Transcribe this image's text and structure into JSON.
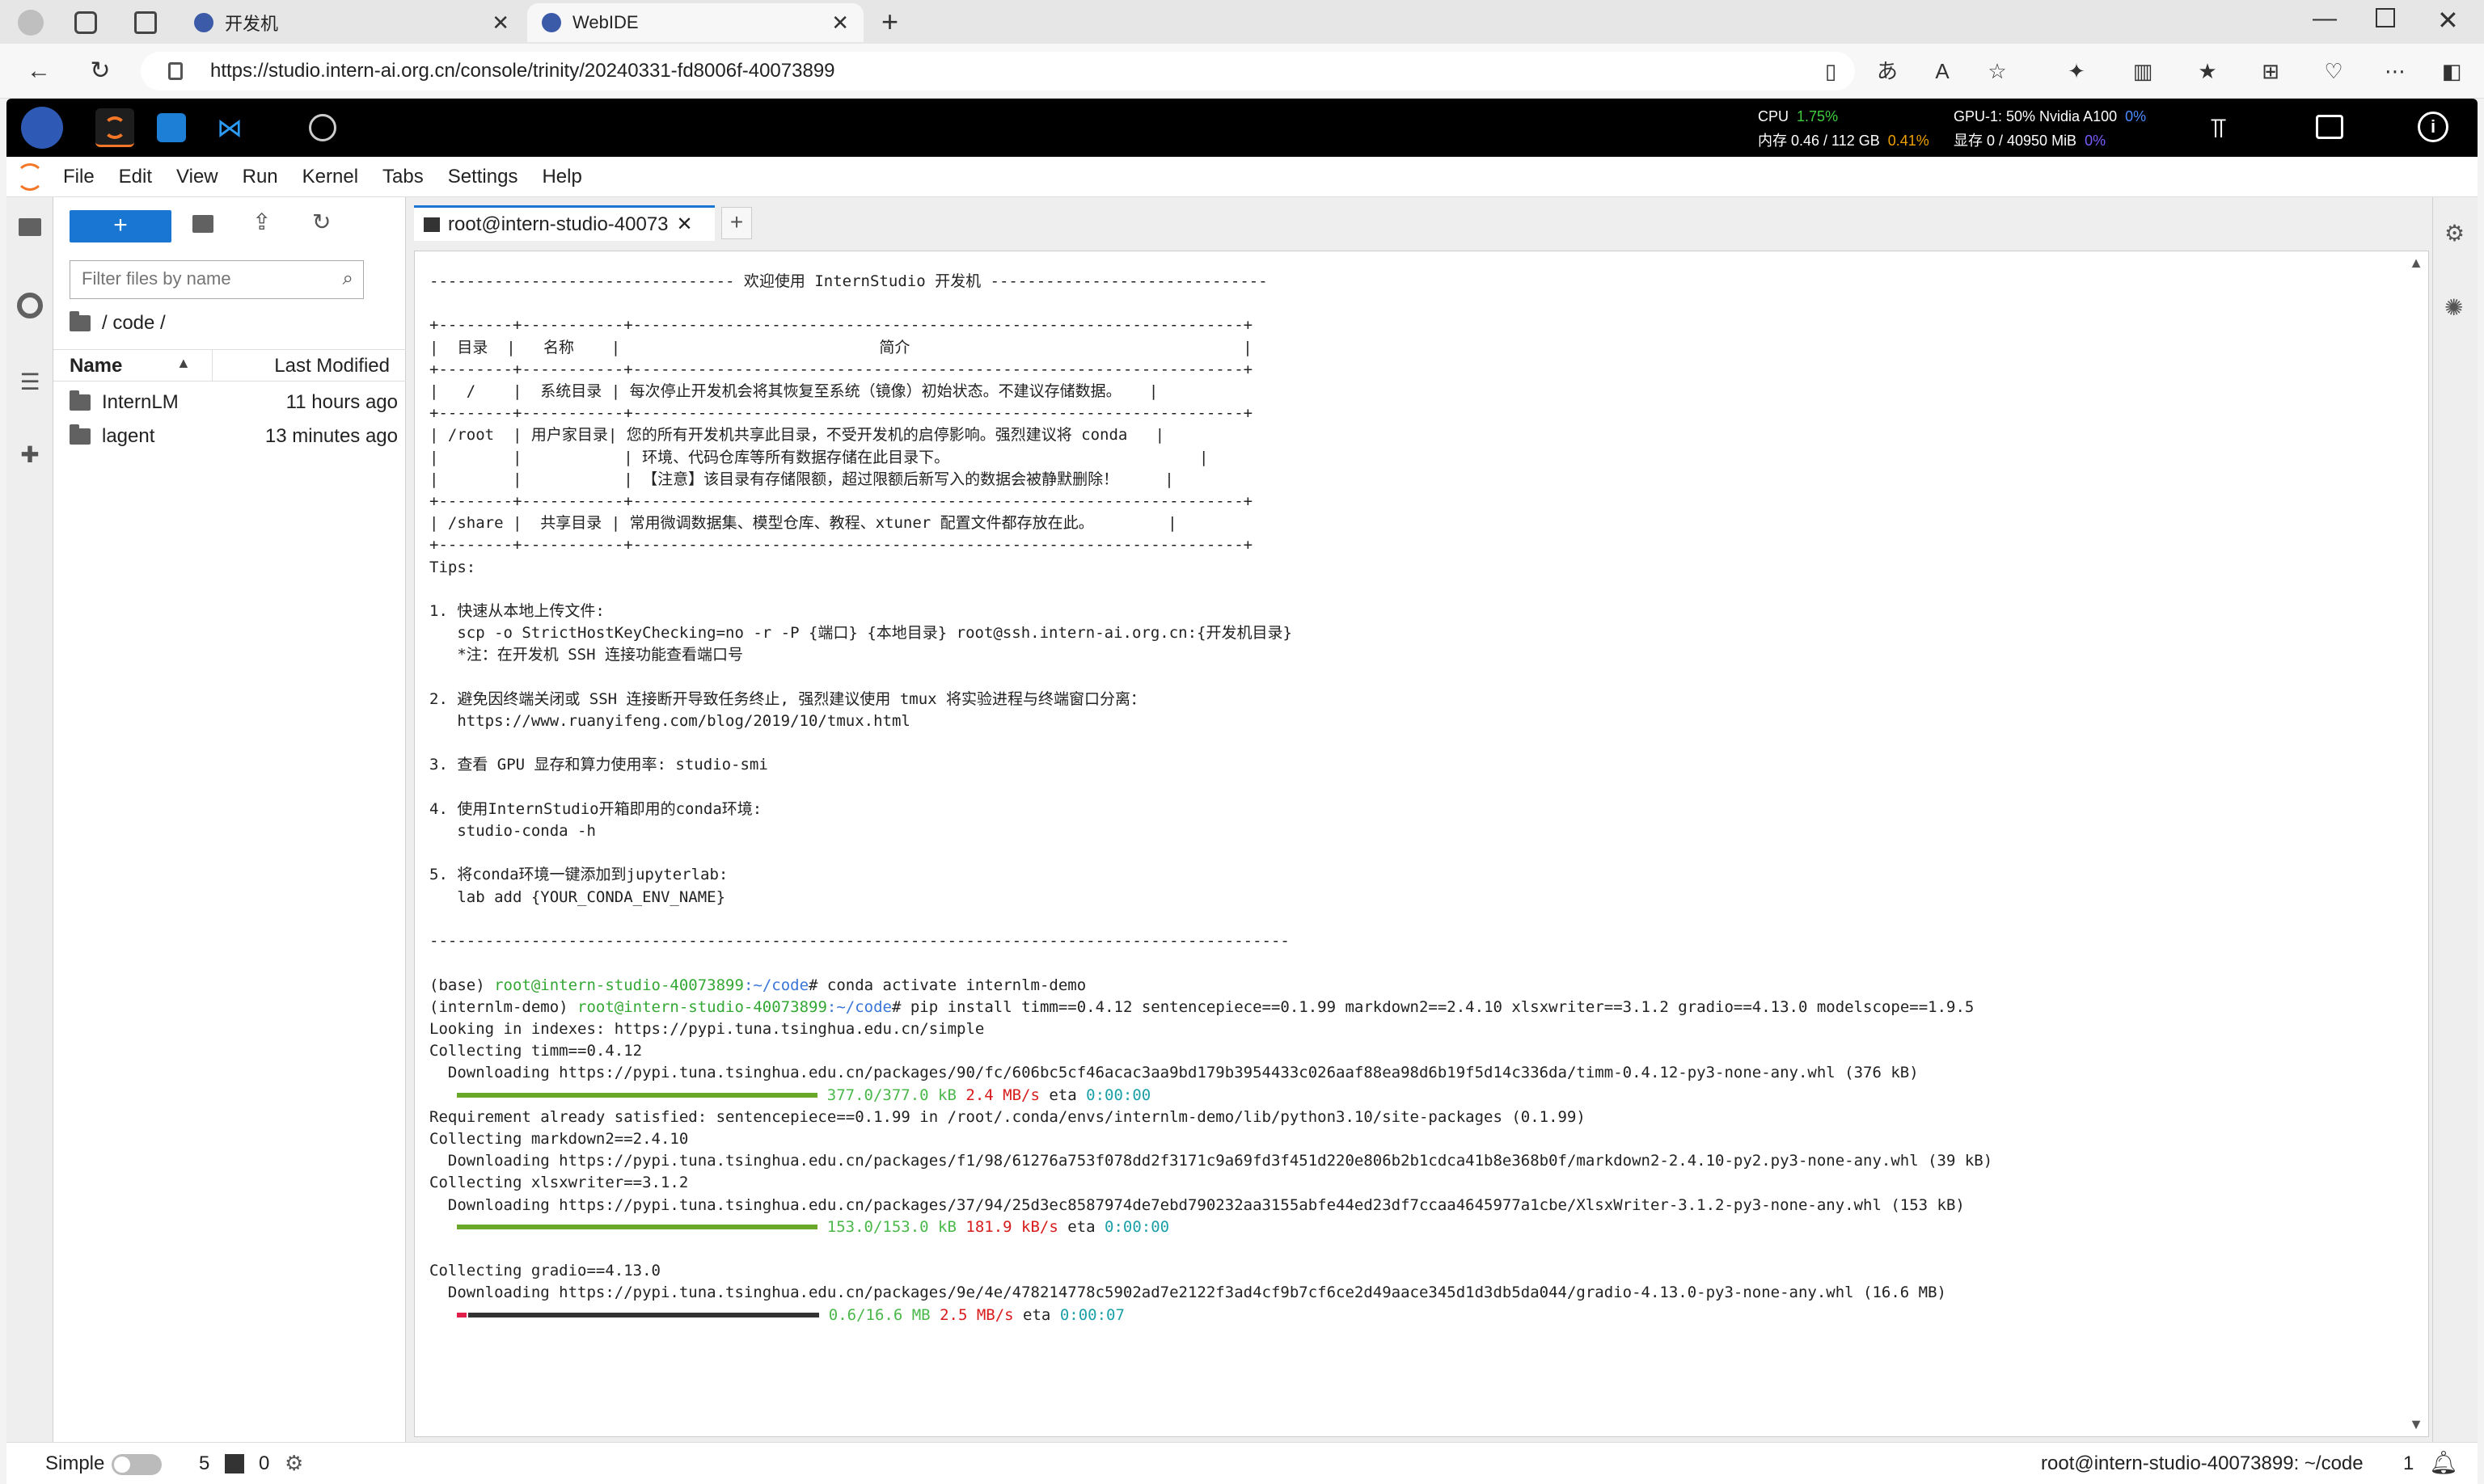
{
  "browser": {
    "tabs": [
      {
        "title": "开发机",
        "active": false
      },
      {
        "title": "WebIDE",
        "active": true
      }
    ],
    "url": "https://studio.intern-ai.org.cn/console/trinity/20240331-fd8006f-40073899"
  },
  "topbar": {
    "cpu_label": "CPU",
    "cpu_value": "1.75%",
    "mem_label": "内存 0.46 / 112 GB",
    "mem_value": "0.41%",
    "gpu_label": "GPU-1: 50% Nvidia A100",
    "gpu_value": "0%",
    "vram_label": "显存 0 / 40950 MiB",
    "vram_value": "0%"
  },
  "menubar": [
    "File",
    "Edit",
    "View",
    "Run",
    "Kernel",
    "Tabs",
    "Settings",
    "Help"
  ],
  "filebrowser": {
    "new_button": "+",
    "filter_placeholder": "Filter files by name",
    "breadcrumb": "/ code /",
    "col_name": "Name",
    "col_modified": "Last Modified",
    "items": [
      {
        "name": "InternLM",
        "modified": "11 hours ago"
      },
      {
        "name": "lagent",
        "modified": "13 minutes ago"
      }
    ]
  },
  "terminal_tab": {
    "label": "root@intern-studio-40073",
    "add": "+"
  },
  "terminal": {
    "lines": [
      "--------------------------------- 欢迎使用 InternStudio 开发机 ------------------------------",
      "",
      "+--------+-----------+------------------------------------------------------------------+",
      "|  目录  |   名称    |                            简介                                    |",
      "+--------+-----------+------------------------------------------------------------------+",
      "|   /    |  系统目录 | 每次停止开发机会将其恢复至系统（镜像）初始状态。不建议存储数据。   |",
      "+--------+-----------+------------------------------------------------------------------+",
      "| /root  | 用户家目录| 您的所有开发机共享此目录，不受开发机的启停影响。强烈建议将 conda   |",
      "|        |           | 环境、代码仓库等所有数据存储在此目录下。                           |",
      "|        |           | 【注意】该目录有存储限额，超过限额后新写入的数据会被静默删除！     |",
      "+--------+-----------+------------------------------------------------------------------+",
      "| /share |  共享目录 | 常用微调数据集、模型仓库、教程、xtuner 配置文件都存放在此。        |",
      "+--------+-----------+------------------------------------------------------------------+",
      "Tips:",
      "",
      "1. 快速从本地上传文件:",
      "   scp -o StrictHostKeyChecking=no -r -P {端口} {本地目录} root@ssh.intern-ai.org.cn:{开发机目录}",
      "   *注：在开发机 SSH 连接功能查看端口号",
      "",
      "2. 避免因终端关闭或 SSH 连接断开导致任务终止, 强烈建议使用 tmux 将实验进程与终端窗口分离：",
      "   https://www.ruanyifeng.com/blog/2019/10/tmux.html",
      "",
      "3. 查看 GPU 显存和算力使用率: studio-smi",
      "",
      "4. 使用InternStudio开箱即用的conda环境:",
      "   studio-conda -h",
      "",
      "5. 将conda环境一键添加到jupyterlab:",
      "   lab add {YOUR_CONDA_ENV_NAME}",
      "",
      "---------------------------------------------------------------------------------------------",
      ""
    ],
    "prompt1_prefix": "(base) ",
    "prompt_host": "root@intern-studio-40073899",
    "prompt_path": ":~/code",
    "prompt1_cmd": "# conda activate internlm-demo",
    "prompt2_prefix": "(internlm-demo) ",
    "prompt2_cmd": "# pip install timm==0.4.12 sentencepiece==0.1.99 markdown2==2.4.10 xlsxwriter==3.1.2 gradio==4.13.0 modelscope==1.9.5",
    "out1": "Looking in indexes: https://pypi.tuna.tsinghua.edu.cn/simple",
    "out2": "Collecting timm==0.4.12",
    "out3": "  Downloading https://pypi.tuna.tsinghua.edu.cn/packages/90/fc/606bc5cf46acac3aa9bd179b3954433c026aaf88ea98d6b19f5d14c336da/timm-0.4.12-py3-none-any.whl (376 kB)",
    "prog1_size": "377.0/377.0 kB",
    "prog1_speed": "2.4 MB/s",
    "prog1_eta": "0:00:00",
    "out4": "Requirement already satisfied: sentencepiece==0.1.99 in /root/.conda/envs/internlm-demo/lib/python3.10/site-packages (0.1.99)",
    "out5": "Collecting markdown2==2.4.10",
    "out6": "  Downloading https://pypi.tuna.tsinghua.edu.cn/packages/f1/98/61276a753f078dd2f3171c9a69fd3f451d220e806b2b1cdca41b8e368b0f/markdown2-2.4.10-py2.py3-none-any.whl (39 kB)",
    "out7": "Collecting xlsxwriter==3.1.2",
    "out8": "  Downloading https://pypi.tuna.tsinghua.edu.cn/packages/37/94/25d3ec8587974de7ebd790232aa3155abfe44ed23df7ccaa4645977a1cbe/XlsxWriter-3.1.2-py3-none-any.whl (153 kB)",
    "prog2_size": "153.0/153.0 kB",
    "prog2_speed": "181.9 kB/s",
    "prog2_eta": "0:00:00",
    "out9": "Collecting gradio==4.13.0",
    "out10": "  Downloading https://pypi.tuna.tsinghua.edu.cn/packages/9e/4e/478214778c5902ad7e2122f3ad4cf9b7cf6ce2d49aace345d1d3db5da044/gradio-4.13.0-py3-none-any.whl (16.6 MB)",
    "prog3_size": "0.6/16.6 MB",
    "prog3_speed": "2.5 MB/s",
    "prog3_eta": "0:00:07",
    "eta_label": "eta"
  },
  "statusbar": {
    "mode": "Simple",
    "count1": "5",
    "count2": "0",
    "right_text": "root@intern-studio-40073899: ~/code",
    "right_num": "1"
  },
  "colors": {
    "accent": "#1976d2",
    "topbar": "#000000"
  }
}
